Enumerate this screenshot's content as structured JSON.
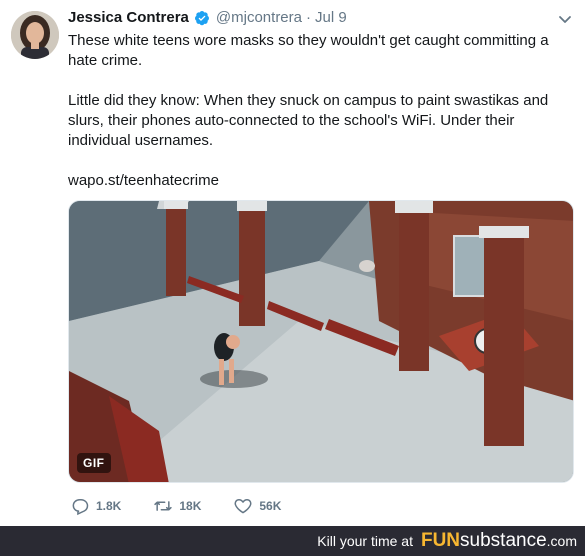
{
  "tweet": {
    "author_name": "Jessica Contrera",
    "handle": "@mjcontrera",
    "separator": "·",
    "date": "Jul 9",
    "paragraph_1": "These white teens wore masks so they wouldn't get caught committing a hate crime.",
    "paragraph_2": "Little did they know: When they snuck on campus to paint swastikas and slurs, their phones auto-connected to the school's WiFi. Under their individual usernames.",
    "link": "wapo.st/teenhatecrime",
    "media_badge": "GIF"
  },
  "actions": {
    "replies": "1.8K",
    "retweets": "18K",
    "likes": "56K"
  },
  "icons": {
    "verified": "verified-badge-icon",
    "menu": "chevron-down-icon",
    "reply": "reply-icon",
    "retweet": "retweet-icon",
    "like": "heart-icon"
  },
  "colors": {
    "verified_blue": "#1da1f2",
    "secondary_text": "#657786",
    "footer_bg": "#2a2a33",
    "brand_accent": "#f7b731"
  },
  "footer": {
    "tagline": "Kill your time at",
    "brand_fun": "FUN",
    "brand_substance": "substance",
    "brand_tld": ".com"
  }
}
